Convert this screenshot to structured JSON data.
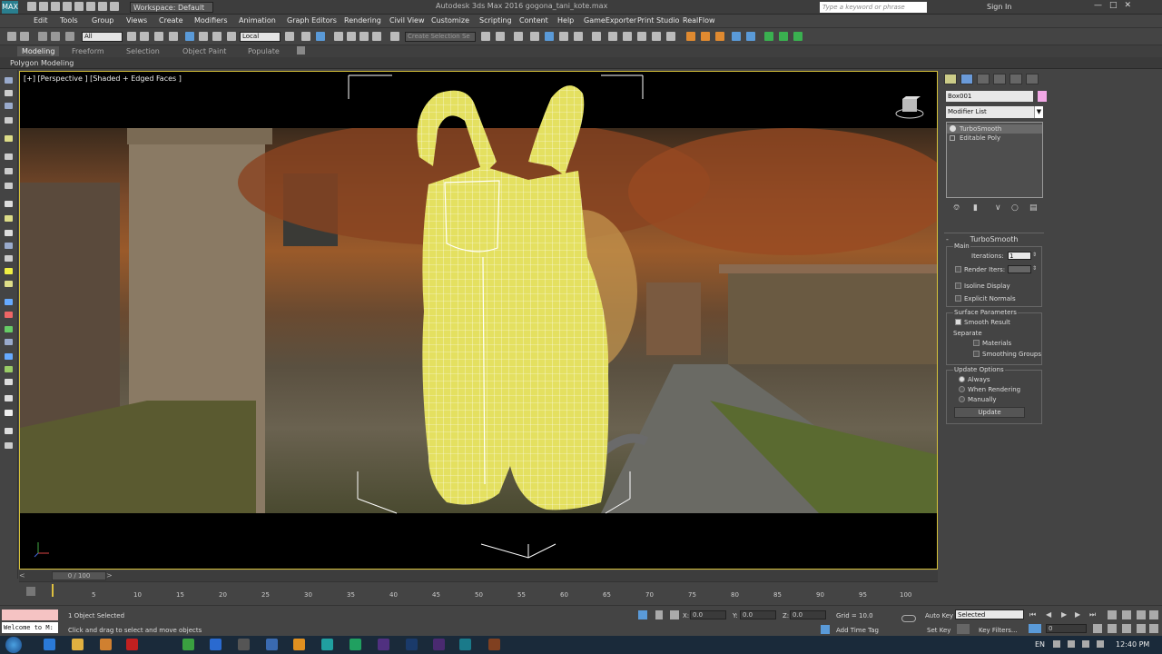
{
  "titlebar": {
    "workspace": "Workspace: Default",
    "window_title": "Autodesk 3ds Max 2016   gogona_tani_kote.max",
    "search_placeholder": "Type a keyword or phrase",
    "sign_in": "Sign In",
    "logo_text": "MAX"
  },
  "menu": [
    "Edit",
    "Tools",
    "Group",
    "Views",
    "Create",
    "Modifiers",
    "Animation",
    "Graph Editors",
    "Rendering",
    "Civil View",
    "Customize",
    "Scripting",
    "Content",
    "Help",
    "GameExporter",
    "Print Studio",
    "RealFlow"
  ],
  "toolbar": {
    "selection_filter": "All",
    "ref_coord": "Local",
    "named_selection": "Create Selection Se"
  },
  "ribbon": {
    "tabs": [
      "Modeling",
      "Freeform",
      "Selection",
      "Object Paint",
      "Populate"
    ],
    "active_tab": "Modeling",
    "subtitle": "Polygon Modeling"
  },
  "viewport": {
    "label": "[+] [Perspective ] [Shaded + Edged Faces ]"
  },
  "command_panel": {
    "object_name": "Box001",
    "object_color": "#f2a8e6",
    "modifier_list": "Modifier List",
    "stack": [
      "TurboSmooth",
      "Editable Poly"
    ],
    "rollout_title": "TurboSmooth",
    "main_label": "Main",
    "iterations_label": "Iterations:",
    "iterations_value": "1",
    "render_iters_label": "Render Iters:",
    "render_iters_value": "",
    "isoline_display": "Isoline Display",
    "explicit_normals": "Explicit Normals",
    "surface_params": "Surface Parameters",
    "smooth_result": "Smooth Result",
    "separate": "Separate",
    "materials": "Materials",
    "smoothing_groups": "Smoothing Groups",
    "update_options": "Update Options",
    "always": "Always",
    "when_rendering": "When Rendering",
    "manually": "Manually",
    "update_button": "Update"
  },
  "timeline": {
    "slider_label": "0 / 100",
    "ticks": [
      "5",
      "10",
      "15",
      "20",
      "25",
      "30",
      "35",
      "40",
      "45",
      "50",
      "55",
      "60",
      "65",
      "70",
      "75",
      "80",
      "85",
      "90",
      "95",
      "100"
    ]
  },
  "status": {
    "welcome": "Welcome to M:",
    "selected": "1 Object Selected",
    "prompt": "Click and drag to select and move objects",
    "x_label": "X:",
    "x_value": "0.0",
    "y_label": "Y:",
    "y_value": "0.0",
    "z_label": "Z:",
    "z_value": "0.0",
    "grid": "Grid = 10.0",
    "add_time_tag": "Add Time Tag",
    "auto_key": "Auto Key",
    "set_key": "Set Key",
    "key_mode": "Selected",
    "key_filters": "Key Filters...",
    "frame": "0"
  },
  "taskbar": {
    "language": "EN",
    "clock": "12:40 PM"
  }
}
